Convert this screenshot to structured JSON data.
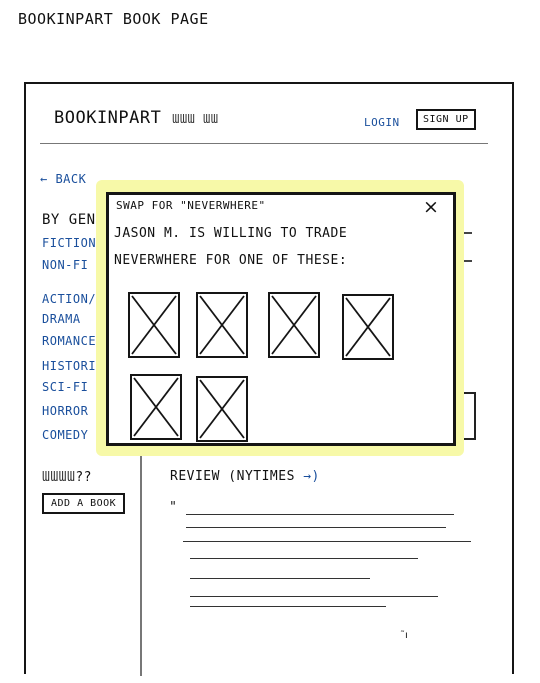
{
  "page_caption": "BookInPart Book page",
  "header": {
    "logo": "BookInPart",
    "login_label": "Login",
    "signup_label": "Sign up"
  },
  "sidebar": {
    "back_label": "← Back",
    "genre_heading": "By Gen",
    "genres_top": [
      "Fiction",
      "Non-Fi"
    ],
    "genres": [
      "Action/",
      "Drama",
      "Romance",
      "Historic",
      "Sci-Fi",
      "Horror",
      "Comedy"
    ],
    "add_prompt": "??",
    "add_button_label": "Add a Book"
  },
  "review": {
    "heading": "Review (NYTimes",
    "arrow": "→)",
    "quote_mark": "\""
  },
  "modal": {
    "title": "Swap for \"Neverwhere\"",
    "close_label": "×",
    "message_line1": "Jason M. is willing to trade",
    "message_line2": "Neverwhere for one of these:",
    "book_count": 6
  }
}
